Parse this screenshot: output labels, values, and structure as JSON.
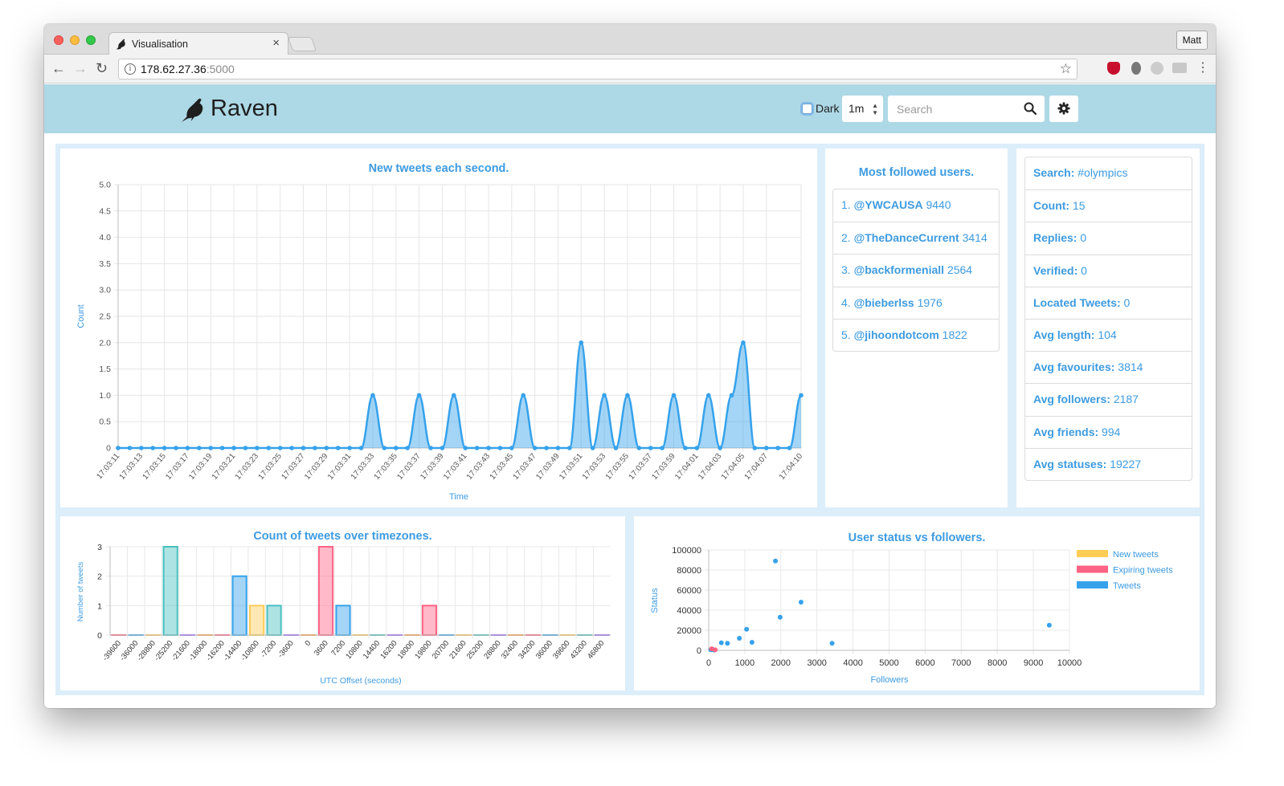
{
  "browser": {
    "tab_title": "Visualisation",
    "tab_close": "×",
    "profile_name": "Matt",
    "url_host": "178.62.27.36",
    "url_port": ":5000"
  },
  "navbar": {
    "brand": "Raven",
    "dark_label": "Dark",
    "range_value": "1m",
    "search_placeholder": "Search"
  },
  "colors": {
    "accent": "#3d9be0",
    "navbar": "#add8e6",
    "teal": "#4bc0c0",
    "blue": "#36a2eb",
    "yellow": "#ffcd56",
    "pink": "#ff6384"
  },
  "followed": {
    "title": "Most followed users.",
    "items": [
      {
        "rank": "1.",
        "handle": "@YWCAUSA",
        "count": "9440"
      },
      {
        "rank": "2.",
        "handle": "@TheDanceCurrent",
        "count": "3414"
      },
      {
        "rank": "3.",
        "handle": "@backformeniall",
        "count": "2564"
      },
      {
        "rank": "4.",
        "handle": "@bieberlss",
        "count": "1976"
      },
      {
        "rank": "5.",
        "handle": "@jihoondotcom",
        "count": "1822"
      }
    ]
  },
  "stats": [
    {
      "label": "Search:",
      "value": "#olympics"
    },
    {
      "label": "Count:",
      "value": "15"
    },
    {
      "label": "Replies:",
      "value": "0"
    },
    {
      "label": "Verified:",
      "value": "0"
    },
    {
      "label": "Located Tweets:",
      "value": "0"
    },
    {
      "label": "Avg length:",
      "value": "104"
    },
    {
      "label": "Avg favourites:",
      "value": "3814"
    },
    {
      "label": "Avg followers:",
      "value": "2187"
    },
    {
      "label": "Avg friends:",
      "value": "994"
    },
    {
      "label": "Avg statuses:",
      "value": "19227"
    }
  ],
  "chart_data": [
    {
      "type": "area",
      "title": "New tweets each second.",
      "xlabel": "Time",
      "ylabel": "Count",
      "ylim": [
        0,
        5
      ],
      "yticks": [
        "0",
        "0.5",
        "1.0",
        "1.5",
        "2.0",
        "2.5",
        "3.0",
        "3.5",
        "4.0",
        "4.5",
        "5.0"
      ],
      "x": [
        "17:03:11",
        "17:03:12",
        "17:03:13",
        "17:03:14",
        "17:03:15",
        "17:03:16",
        "17:03:17",
        "17:03:18",
        "17:03:19",
        "17:03:20",
        "17:03:21",
        "17:03:22",
        "17:03:23",
        "17:03:24",
        "17:03:25",
        "17:03:26",
        "17:03:27",
        "17:03:28",
        "17:03:29",
        "17:03:30",
        "17:03:31",
        "17:03:32",
        "17:03:33",
        "17:03:34",
        "17:03:35",
        "17:03:36",
        "17:03:37",
        "17:03:38",
        "17:03:39",
        "17:03:40",
        "17:03:41",
        "17:03:42",
        "17:03:43",
        "17:03:44",
        "17:03:45",
        "17:03:46",
        "17:03:47",
        "17:03:48",
        "17:03:49",
        "17:03:50",
        "17:03:51",
        "17:03:52",
        "17:03:53",
        "17:03:54",
        "17:03:55",
        "17:03:56",
        "17:03:57",
        "17:03:58",
        "17:03:59",
        "17:04:00",
        "17:04:01",
        "17:04:02",
        "17:04:03",
        "17:04:04",
        "17:04:05",
        "17:04:06",
        "17:04:07",
        "17:04:08",
        "17:04:09",
        "17:04:10"
      ],
      "values": [
        0,
        0,
        0,
        0,
        0,
        0,
        0,
        0,
        0,
        0,
        0,
        0,
        0,
        0,
        0,
        0,
        0,
        0,
        0,
        0,
        0,
        0,
        1,
        0,
        0,
        0,
        1,
        0,
        0,
        1,
        0,
        0,
        0,
        0,
        0,
        1,
        0,
        0,
        0,
        0,
        2,
        0,
        1,
        0,
        1,
        0,
        0,
        0,
        1,
        0,
        0,
        1,
        0,
        1,
        2,
        0,
        0,
        0,
        0,
        1
      ],
      "tick_labels": [
        "17:03:11",
        "17:03:13",
        "17:03:15",
        "17:03:17",
        "17:03:19",
        "17:03:21",
        "17:03:23",
        "17:03:25",
        "17:03:27",
        "17:03:29",
        "17:03:31",
        "17:03:33",
        "17:03:35",
        "17:03:37",
        "17:03:39",
        "17:03:41",
        "17:03:43",
        "17:03:45",
        "17:03:47",
        "17:03:49",
        "17:03:51",
        "17:03:53",
        "17:03:55",
        "17:03:57",
        "17:03:59",
        "17:04:01",
        "17:04:03",
        "17:04:05",
        "17:04:07",
        "17:04:10"
      ],
      "grid": true
    },
    {
      "type": "bar",
      "title": "Count of tweets over timezones.",
      "xlabel": "UTC Offset (seconds)",
      "ylabel": "Number of tweets",
      "ylim": [
        0,
        3
      ],
      "yticks": [
        "0",
        "1",
        "2",
        "3"
      ],
      "categories": [
        "-39600",
        "-36000",
        "-28800",
        "-25200",
        "-21600",
        "-18000",
        "-16200",
        "-14400",
        "-10800",
        "-7200",
        "-3600",
        "0",
        "3600",
        "7200",
        "10800",
        "14400",
        "16200",
        "18000",
        "19800",
        "20700",
        "21600",
        "25200",
        "28800",
        "32400",
        "34200",
        "36000",
        "39600",
        "43200",
        "46800"
      ],
      "values": [
        0,
        0,
        0,
        3,
        0,
        0,
        0,
        2,
        1,
        1,
        0,
        0,
        3,
        1,
        0,
        0,
        0,
        0,
        1,
        0,
        0,
        0,
        0,
        0,
        0,
        0,
        0,
        0,
        0
      ],
      "bar_colors": [
        "#ff6384",
        "#36a2eb",
        "#ffcd56",
        "#4bc0c0",
        "#9966ff",
        "#ff9f40",
        "#ff6384",
        "#36a2eb",
        "#ffcd56",
        "#4bc0c0",
        "#9966ff",
        "#ff9f40",
        "#ff6384",
        "#36a2eb",
        "#ffcd56",
        "#4bc0c0",
        "#9966ff",
        "#ff9f40",
        "#ff6384",
        "#36a2eb",
        "#ffcd56",
        "#4bc0c0",
        "#9966ff",
        "#ff9f40",
        "#ff6384",
        "#36a2eb",
        "#ffcd56",
        "#4bc0c0",
        "#9966ff"
      ],
      "grid": true
    },
    {
      "type": "scatter",
      "title": "User status vs followers.",
      "xlabel": "Followers",
      "ylabel": "Status",
      "xlim": [
        0,
        10000
      ],
      "ylim": [
        0,
        100000
      ],
      "xticks": [
        "0",
        "1000",
        "2000",
        "3000",
        "4000",
        "5000",
        "6000",
        "7000",
        "8000",
        "9000",
        "10000"
      ],
      "yticks": [
        "0",
        "20000",
        "40000",
        "60000",
        "80000",
        "100000"
      ],
      "legend_position": "right",
      "series": [
        {
          "name": "New tweets",
          "color": "#ffcd56",
          "points": []
        },
        {
          "name": "Expiring tweets",
          "color": "#ff6384",
          "points": [
            [
              80,
              1500
            ],
            [
              180,
              500
            ]
          ]
        },
        {
          "name": "Tweets",
          "color": "#36a2eb",
          "points": [
            [
              60,
              500
            ],
            [
              150,
              300
            ],
            [
              350,
              7500
            ],
            [
              520,
              7000
            ],
            [
              850,
              12000
            ],
            [
              1050,
              21000
            ],
            [
              1200,
              8000
            ],
            [
              1850,
              89000
            ],
            [
              1980,
              33000
            ],
            [
              2560,
              48000
            ],
            [
              3420,
              7000
            ],
            [
              9440,
              25000
            ],
            [
              120,
              800
            ]
          ]
        }
      ],
      "grid": true
    }
  ]
}
